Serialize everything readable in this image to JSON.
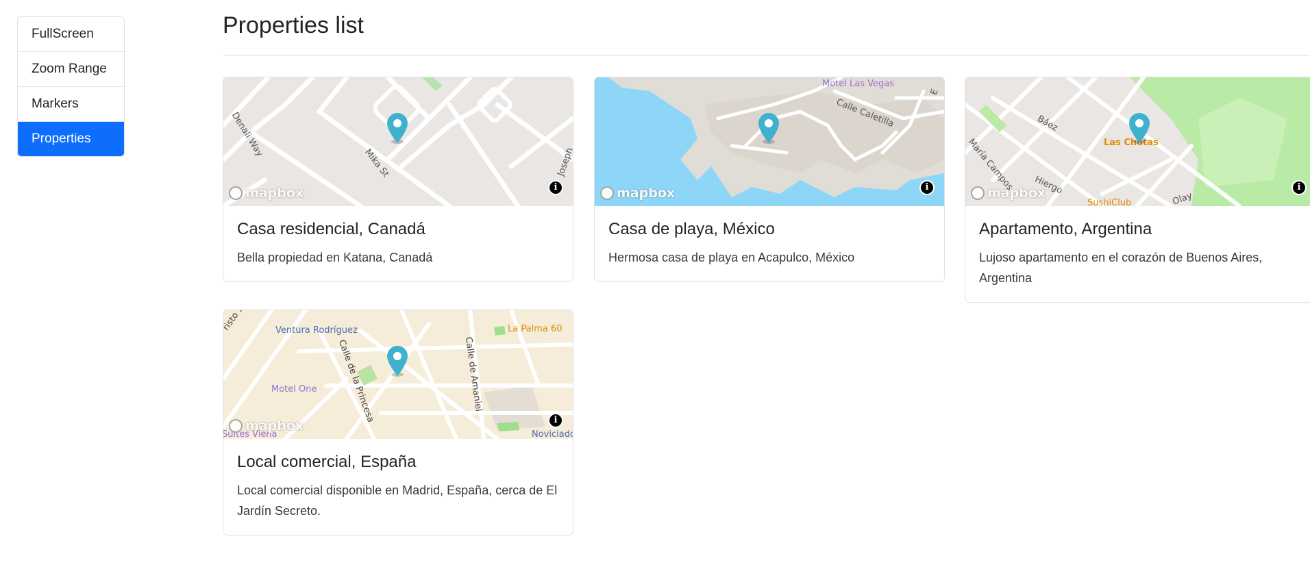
{
  "sidebar": {
    "items": [
      {
        "label": "FullScreen",
        "active": false
      },
      {
        "label": "Zoom Range",
        "active": false
      },
      {
        "label": "Markers",
        "active": false
      },
      {
        "label": "Properties",
        "active": true
      }
    ]
  },
  "page": {
    "title": "Properties list"
  },
  "map_attribution": {
    "logo_text": "mapbox",
    "info_symbol": "i"
  },
  "colors": {
    "accent": "#0d6efd",
    "marker": "#3fb1ce",
    "water": "#8ed6f8"
  },
  "cards": [
    {
      "title": "Casa residencial, Canadá",
      "description": "Bella propiedad en Katana, Canadá",
      "map_labels": [
        "Denali Way",
        "Mika St",
        "Joseph"
      ]
    },
    {
      "title": "Casa de playa, México",
      "description": "Hermosa casa de playa en Acapulco, México",
      "map_labels": [
        "Motel Las Vegas",
        "Calle Caletilla",
        "E"
      ]
    },
    {
      "title": "Apartamento, Argentina",
      "description": "Lujoso apartamento en el corazón de Buenos Aires, Argentina",
      "map_labels": [
        "Báez",
        "Las Chotas",
        "María Campos",
        "Hiergo",
        "SushiClub",
        "Olay"
      ]
    },
    {
      "title": "Local comercial, España",
      "description": "Local comercial disponible en Madrid, España, cerca de El Jardín Secreto.",
      "map_labels": [
        "Ventura Rodríguez",
        "La Palma 60",
        "Calle de la Princesa",
        "Calle de Amaniel",
        "Motel One",
        "Suites Viena",
        "Noviciado",
        "risto S"
      ]
    }
  ]
}
